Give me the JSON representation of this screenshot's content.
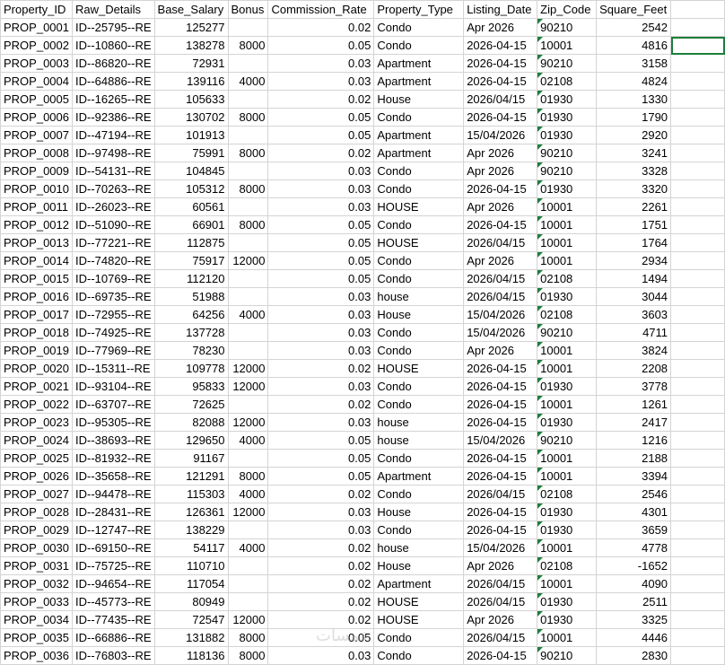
{
  "headers": [
    "Property_ID",
    "Raw_Details",
    "Base_Salary",
    "Bonus",
    "Commission_Rate",
    "Property_Type",
    "Listing_Date",
    "Zip_Code",
    "Square_Feet",
    ""
  ],
  "rows": [
    [
      "PROP_0001",
      "ID--25795--RE",
      "125277",
      "",
      "0.02",
      " Condo",
      "Apr 2026",
      "90210",
      "2542"
    ],
    [
      "PROP_0002",
      "ID--10860--RE",
      "138278",
      "8000",
      "0.05",
      "Condo",
      "2026-04-15",
      "10001",
      "4816"
    ],
    [
      "PROP_0003",
      "ID--86820--RE",
      "72931",
      "",
      "0.03",
      "Apartment",
      "2026-04-15",
      "90210",
      "3158"
    ],
    [
      "PROP_0004",
      "ID--64886--RE",
      "139116",
      "4000",
      "0.03",
      "Apartment",
      "2026-04-15",
      "02108",
      "4824"
    ],
    [
      "PROP_0005",
      "ID--16265--RE",
      "105633",
      "",
      "0.02",
      "House",
      "2026/04/15",
      "01930",
      "1330"
    ],
    [
      "PROP_0006",
      "ID--92386--RE",
      "130702",
      "8000",
      "0.05",
      "Condo",
      "2026-04-15",
      "01930",
      "1790"
    ],
    [
      "PROP_0007",
      "ID--47194--RE",
      "101913",
      "",
      "0.05",
      "Apartment",
      "15/04/2026",
      "01930",
      "2920"
    ],
    [
      "PROP_0008",
      "ID--97498--RE",
      "75991",
      "8000",
      "0.02",
      "Apartment",
      "Apr 2026",
      "90210",
      "3241"
    ],
    [
      "PROP_0009",
      "ID--54131--RE",
      "104845",
      "",
      "0.03",
      "Condo",
      "Apr 2026",
      "90210",
      "3328"
    ],
    [
      "PROP_0010",
      "ID--70263--RE",
      "105312",
      "8000",
      "0.03",
      " Condo",
      "2026-04-15",
      "01930",
      "3320"
    ],
    [
      "PROP_0011",
      "ID--26023--RE",
      "60561",
      "",
      "0.03",
      "HOUSE",
      "Apr 2026",
      "10001",
      "2261"
    ],
    [
      "PROP_0012",
      "ID--51090--RE",
      "66901",
      "8000",
      "0.05",
      "Condo",
      "2026-04-15",
      "10001",
      "1751"
    ],
    [
      "PROP_0013",
      "ID--77221--RE",
      "112875",
      "",
      "0.05",
      "HOUSE",
      "2026/04/15",
      "10001",
      "1764"
    ],
    [
      "PROP_0014",
      "ID--74820--RE",
      "75917",
      "12000",
      "0.05",
      " Condo",
      "Apr 2026",
      "10001",
      "2934"
    ],
    [
      "PROP_0015",
      "ID--10769--RE",
      "112120",
      "",
      "0.05",
      " Condo",
      "2026/04/15",
      "02108",
      "1494"
    ],
    [
      "PROP_0016",
      "ID--69735--RE",
      "51988",
      "",
      "0.03",
      "house",
      "2026/04/15",
      "01930",
      "3044"
    ],
    [
      "PROP_0017",
      "ID--72955--RE",
      "64256",
      "4000",
      "0.03",
      "House",
      "15/04/2026",
      "02108",
      "3603"
    ],
    [
      "PROP_0018",
      "ID--74925--RE",
      "137728",
      "",
      "0.03",
      " Condo",
      "15/04/2026",
      "90210",
      "4711"
    ],
    [
      "PROP_0019",
      "ID--77969--RE",
      "78230",
      "",
      "0.03",
      " Condo",
      "Apr 2026",
      "10001",
      "3824"
    ],
    [
      "PROP_0020",
      "ID--15311--RE",
      "109778",
      "12000",
      "0.02",
      "HOUSE",
      "2026-04-15",
      "10001",
      "2208"
    ],
    [
      "PROP_0021",
      "ID--93104--RE",
      "95833",
      "12000",
      "0.03",
      " Condo",
      "2026-04-15",
      "01930",
      "3778"
    ],
    [
      "PROP_0022",
      "ID--63707--RE",
      "72625",
      "",
      "0.02",
      "Condo",
      "2026-04-15",
      "10001",
      "1261"
    ],
    [
      "PROP_0023",
      "ID--95305--RE",
      "82088",
      "12000",
      "0.03",
      "house",
      "2026-04-15",
      "01930",
      "2417"
    ],
    [
      "PROP_0024",
      "ID--38693--RE",
      "129650",
      "4000",
      "0.05",
      "house",
      "15/04/2026",
      "90210",
      "1216"
    ],
    [
      "PROP_0025",
      "ID--81932--RE",
      "91167",
      "",
      "0.05",
      "Condo",
      "2026-04-15",
      "10001",
      "2188"
    ],
    [
      "PROP_0026",
      "ID--35658--RE",
      "121291",
      "8000",
      "0.05",
      "Apartment",
      "2026-04-15",
      "10001",
      "3394"
    ],
    [
      "PROP_0027",
      "ID--94478--RE",
      "115303",
      "4000",
      "0.02",
      " Condo",
      "2026/04/15",
      "02108",
      "2546"
    ],
    [
      "PROP_0028",
      "ID--28431--RE",
      "126361",
      "12000",
      "0.03",
      "House",
      "2026-04-15",
      "01930",
      "4301"
    ],
    [
      "PROP_0029",
      "ID--12747--RE",
      "138229",
      "",
      "0.03",
      " Condo",
      "2026-04-15",
      "01930",
      "3659"
    ],
    [
      "PROP_0030",
      "ID--69150--RE",
      "54117",
      "4000",
      "0.02",
      "house",
      "15/04/2026",
      "10001",
      "4778"
    ],
    [
      "PROP_0031",
      "ID--75725--RE",
      "110710",
      "",
      "0.02",
      "House",
      "Apr 2026",
      "02108",
      "-1652"
    ],
    [
      "PROP_0032",
      "ID--94654--RE",
      "117054",
      "",
      "0.02",
      "Apartment",
      "2026/04/15",
      "10001",
      "4090"
    ],
    [
      "PROP_0033",
      "ID--45773--RE",
      "80949",
      "",
      "0.02",
      "HOUSE",
      "2026/04/15",
      "01930",
      "2511"
    ],
    [
      "PROP_0034",
      "ID--77435--RE",
      "72547",
      "12000",
      "0.02",
      "HOUSE",
      "Apr 2026",
      "01930",
      "3325"
    ],
    [
      "PROP_0035",
      "ID--66886--RE",
      "131882",
      "8000",
      "0.05",
      " Condo",
      "2026/04/15",
      "10001",
      "4446"
    ],
    [
      "PROP_0036",
      "ID--76803--RE",
      "118136",
      "8000",
      "0.03",
      " Condo",
      "2026-04-15",
      "90210",
      "2830"
    ]
  ],
  "selection_color": "#1e7e3c",
  "grid_color": "#d4d4d4"
}
